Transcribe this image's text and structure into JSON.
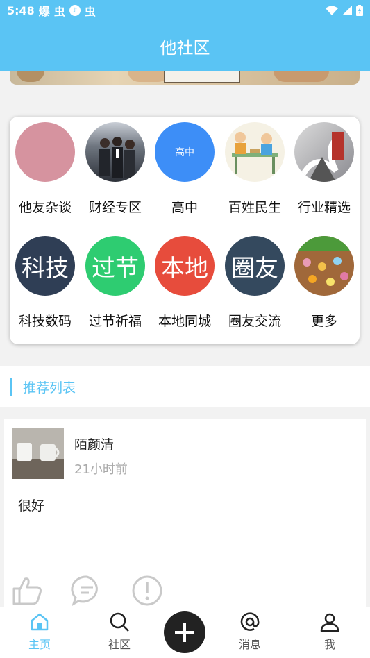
{
  "status_bar": {
    "time": "5:48",
    "indicators": [
      "爆",
      "虫"
    ],
    "app_icon": "music-note-icon",
    "extra": "虫"
  },
  "header": {
    "title": "他社区"
  },
  "categories": [
    {
      "label": "他友杂谈",
      "icon_text": "",
      "color": "#d6939f"
    },
    {
      "label": "财经专区",
      "icon_text": "",
      "color": "#7a7f88"
    },
    {
      "label": "高中",
      "icon_text": "高中",
      "color": "#3d8ef7"
    },
    {
      "label": "百姓民生",
      "icon_text": "",
      "color": "#e9e2cd"
    },
    {
      "label": "行业精选",
      "icon_text": "",
      "color": "#9a9aa0"
    },
    {
      "label": "科技数码",
      "icon_text": "科技",
      "color": "#2f3e55"
    },
    {
      "label": "过节祈福",
      "icon_text": "过节",
      "color": "#2ecc71"
    },
    {
      "label": "本地同城",
      "icon_text": "本地",
      "color": "#e74c3c"
    },
    {
      "label": "圈友交流",
      "icon_text": "圈友",
      "color": "#34495e"
    },
    {
      "label": "更多",
      "icon_text": "",
      "color": "#a0683a"
    }
  ],
  "recommend": {
    "title": "推荐列表"
  },
  "post": {
    "author": "陌颜清",
    "time": "21小时前",
    "content": "很好"
  },
  "nav": {
    "home": "主页",
    "community": "社区",
    "messages": "消息",
    "me": "我"
  },
  "colors": {
    "accent": "#5ac4f4"
  }
}
